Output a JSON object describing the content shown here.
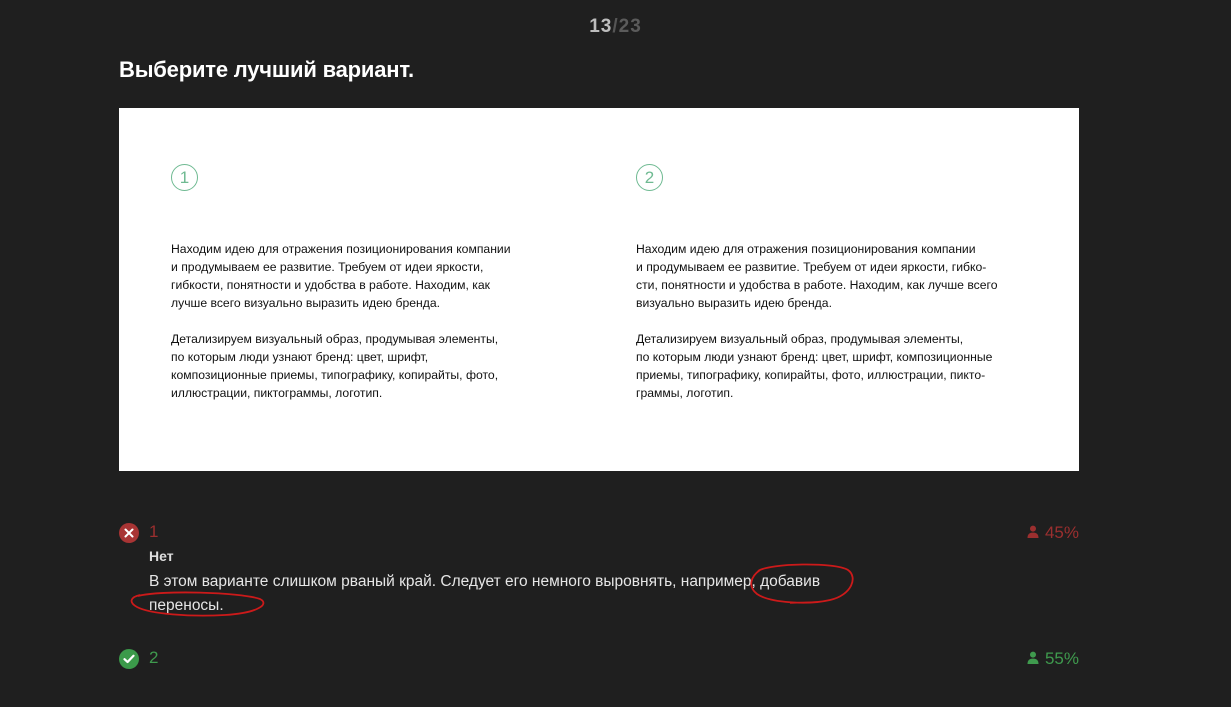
{
  "counter": {
    "current": "13",
    "separator": "/",
    "total": "23"
  },
  "question": {
    "title": "Выберите лучший вариант."
  },
  "variants": [
    {
      "number": "1",
      "paragraph_1": [
        "Находим идею для отражения позиционирования компании",
        "и продумываем ее развитие. Требуем от идеи яркости,",
        "гибкости, понятности и удобства в работе. Находим, как",
        "лучше всего визуально выразить идею бренда."
      ],
      "paragraph_2": [
        "Детализируем визуальный образ, продумывая элементы,",
        "по которым люди узнают бренд: цвет, шрифт,",
        "композиционные приемы, типографику, копирайты, фото,",
        "иллюстрации, пиктограммы, логотип."
      ]
    },
    {
      "number": "2",
      "paragraph_1": [
        "Находим идею для отражения позиционирования компании",
        "и продумываем ее развитие. Требуем от идеи яркости, гибко-",
        "сти, понятности и удобства в работе. Находим, как лучше всего",
        "визуально выразить идею бренда."
      ],
      "paragraph_2": [
        "Детализируем визуальный образ, продумывая элементы,",
        "по которым люди узнают бренд: цвет, шрифт, композиционные",
        "приемы, типографику, копирайты, фото, иллюстрации, пикто-",
        "граммы, логотип."
      ]
    }
  ],
  "answers": [
    {
      "number": "1",
      "status": "wrong",
      "status_icon": "x-icon",
      "percent": "45%",
      "verdict": "Нет",
      "comment_lines": [
        "В этом варианте слишком рваный край. Следует его немного выровнять, например, добавив",
        "переносы."
      ]
    },
    {
      "number": "2",
      "status": "correct",
      "status_icon": "check-icon",
      "percent": "55%"
    }
  ],
  "colors": {
    "background": "#1f1f1f",
    "wrong": "#a83434",
    "correct": "#3b9a4a",
    "circle": "#6fba92",
    "annotation": "#cc1a1a"
  }
}
